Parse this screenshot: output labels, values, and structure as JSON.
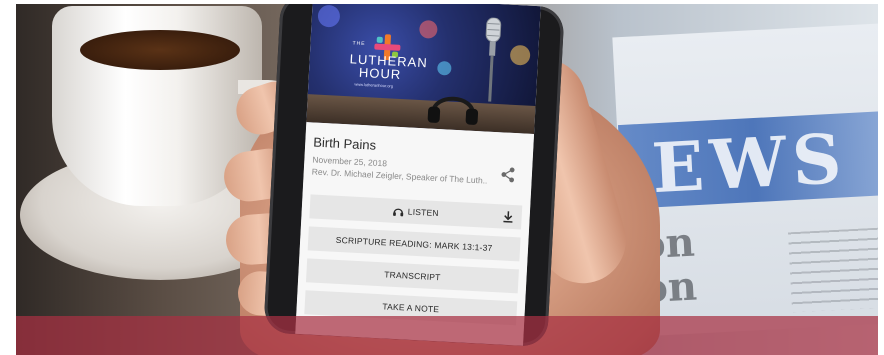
{
  "background_scene": {
    "newspaper_word": "EWS",
    "newspaper_snippet": "on\non"
  },
  "app": {
    "logo": {
      "line_small": "THE",
      "line1": "LUTHERAN",
      "line2": "HOUR",
      "url": "www.lutheranhour.org"
    },
    "episode": {
      "title": "Birth Pains",
      "date": "November 25, 2018",
      "author": "Rev. Dr. Michael Zeigler, Speaker of The Luth..."
    },
    "buttons": {
      "listen": "LISTEN",
      "scripture": "SCRIPTURE READING: MARK 13:1-37",
      "transcript": "TRANSCRIPT",
      "note": "TAKE A NOTE"
    },
    "icons": {
      "headset": "headphones-icon",
      "download": "download-icon",
      "share": "share-icon"
    }
  },
  "colors": {
    "footer_bar": "#a83042",
    "button_bg": "#e6e6e6",
    "screen_bg": "#f7f7f7"
  }
}
